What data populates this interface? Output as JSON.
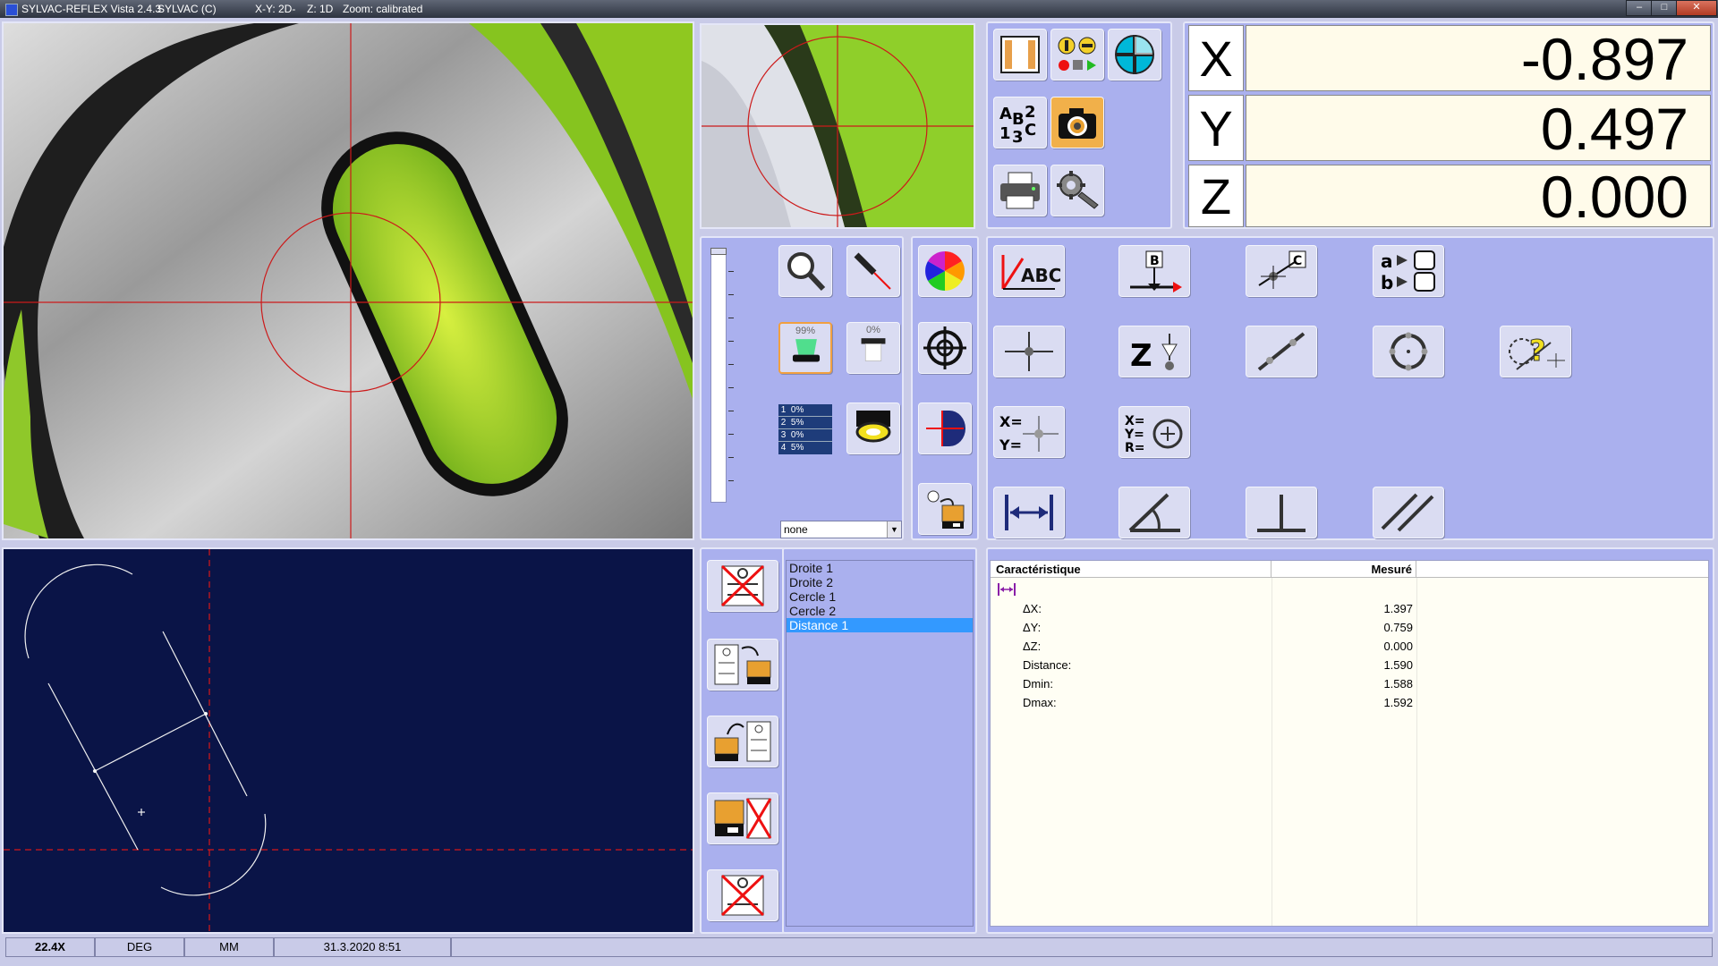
{
  "titlebar": {
    "app": "SYLVAC-REFLEX Vista 2.4.3",
    "profile": "SYLVAC (C)",
    "mode_xy": "X-Y: 2D-",
    "mode_z": "Z: 1D",
    "zoom": "Zoom: calibrated"
  },
  "coords": {
    "x_label": "X",
    "x_value": "-0.897",
    "y_label": "Y",
    "y_value": "0.497",
    "z_label": "Z",
    "z_value": "0.000"
  },
  "light": {
    "top_pct": "99%",
    "bottom_pct": "0%",
    "segments": [
      {
        "n": "1",
        "pct": "0%"
      },
      {
        "n": "2",
        "pct": "5%"
      },
      {
        "n": "3",
        "pct": "0%"
      },
      {
        "n": "4",
        "pct": "5%"
      }
    ],
    "filter_select": "none"
  },
  "entities": [
    "Droite 1",
    "Droite 2",
    "Cercle 1",
    "Cercle 2",
    "Distance 1"
  ],
  "selected_entity": "Distance 1",
  "results": {
    "col_feature": "Caractéristique",
    "col_measured": "Mesuré",
    "rows": [
      {
        "label": "ΔX:",
        "value": "1.397"
      },
      {
        "label": "ΔY:",
        "value": "0.759"
      },
      {
        "label": "ΔZ:",
        "value": "0.000"
      },
      {
        "label": "Distance:",
        "value": "1.590"
      },
      {
        "label": "Dmin:",
        "value": "1.588"
      },
      {
        "label": "Dmax:",
        "value": "1.592"
      }
    ]
  },
  "status": {
    "magnification": "22.4X",
    "angle_unit": "DEG",
    "length_unit": "MM",
    "datetime": "31.3.2020  8:51"
  },
  "colors": {
    "panel": "#aab0ee",
    "drawing_bg": "#0a1447",
    "crosshair": "#e01818",
    "selection": "#3399ff"
  }
}
